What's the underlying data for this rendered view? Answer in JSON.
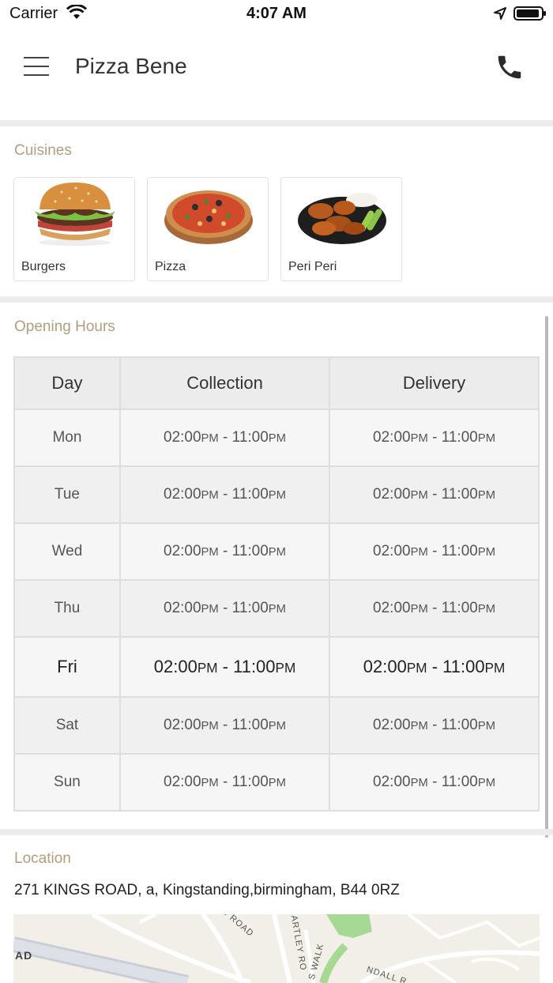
{
  "status_bar": {
    "carrier": "Carrier",
    "time": "4:07 AM"
  },
  "header": {
    "title": "Pizza Bene",
    "icons": [
      "menu-icon",
      "phone-icon"
    ]
  },
  "cuisines": {
    "title": "Cuisines",
    "items": [
      {
        "label": "Burgers",
        "icon": "burger-image"
      },
      {
        "label": "Pizza",
        "icon": "pizza-image"
      },
      {
        "label": "Peri Peri",
        "icon": "wings-image"
      }
    ]
  },
  "opening_hours": {
    "title": "Opening Hours",
    "columns": [
      "Day",
      "Collection",
      "Delivery"
    ],
    "rows": [
      {
        "day": "Mon",
        "collection": {
          "open": "02:00",
          "open_ampm": "PM",
          "sep": " - ",
          "close": "11:00",
          "close_ampm": "PM"
        },
        "delivery": {
          "open": "02:00",
          "open_ampm": "PM",
          "sep": " - ",
          "close": "11:00",
          "close_ampm": "PM"
        }
      },
      {
        "day": "Tue",
        "collection": {
          "open": "02:00",
          "open_ampm": "PM",
          "sep": " - ",
          "close": "11:00",
          "close_ampm": "PM"
        },
        "delivery": {
          "open": "02:00",
          "open_ampm": "PM",
          "sep": " - ",
          "close": "11:00",
          "close_ampm": "PM"
        }
      },
      {
        "day": "Wed",
        "collection": {
          "open": "02:00",
          "open_ampm": "PM",
          "sep": " - ",
          "close": "11:00",
          "close_ampm": "PM"
        },
        "delivery": {
          "open": "02:00",
          "open_ampm": "PM",
          "sep": " - ",
          "close": "11:00",
          "close_ampm": "PM"
        }
      },
      {
        "day": "Thu",
        "collection": {
          "open": "02:00",
          "open_ampm": "PM",
          "sep": " - ",
          "close": "11:00",
          "close_ampm": "PM"
        },
        "delivery": {
          "open": "02:00",
          "open_ampm": "PM",
          "sep": " - ",
          "close": "11:00",
          "close_ampm": "PM"
        }
      },
      {
        "day": "Fri",
        "collection": {
          "open": "02:00",
          "open_ampm": "PM",
          "sep": " - ",
          "close": "11:00",
          "close_ampm": "PM"
        },
        "delivery": {
          "open": "02:00",
          "open_ampm": "PM",
          "sep": " - ",
          "close": "11:00",
          "close_ampm": "PM"
        }
      },
      {
        "day": "Sat",
        "collection": {
          "open": "02:00",
          "open_ampm": "PM",
          "sep": " - ",
          "close": "11:00",
          "close_ampm": "PM"
        },
        "delivery": {
          "open": "02:00",
          "open_ampm": "PM",
          "sep": " - ",
          "close": "11:00",
          "close_ampm": "PM"
        }
      },
      {
        "day": "Sun",
        "collection": {
          "open": "02:00",
          "open_ampm": "PM",
          "sep": " - ",
          "close": "11:00",
          "close_ampm": "PM"
        },
        "delivery": {
          "open": "02:00",
          "open_ampm": "PM",
          "sep": " - ",
          "close": "11:00",
          "close_ampm": "PM"
        }
      }
    ],
    "highlighted_day": "Fri"
  },
  "location": {
    "title": "Location",
    "address": "271 KINGS ROAD, a, Kingstanding,birmingham, B44 0RZ",
    "map_labels": [
      "AD",
      "AD ROAD",
      "HARTLEY RO",
      "S WALK",
      "NDALL R"
    ]
  },
  "colors": {
    "section_title": "#b29e7c",
    "separator": "#ececec",
    "table_header": "#ececec"
  }
}
